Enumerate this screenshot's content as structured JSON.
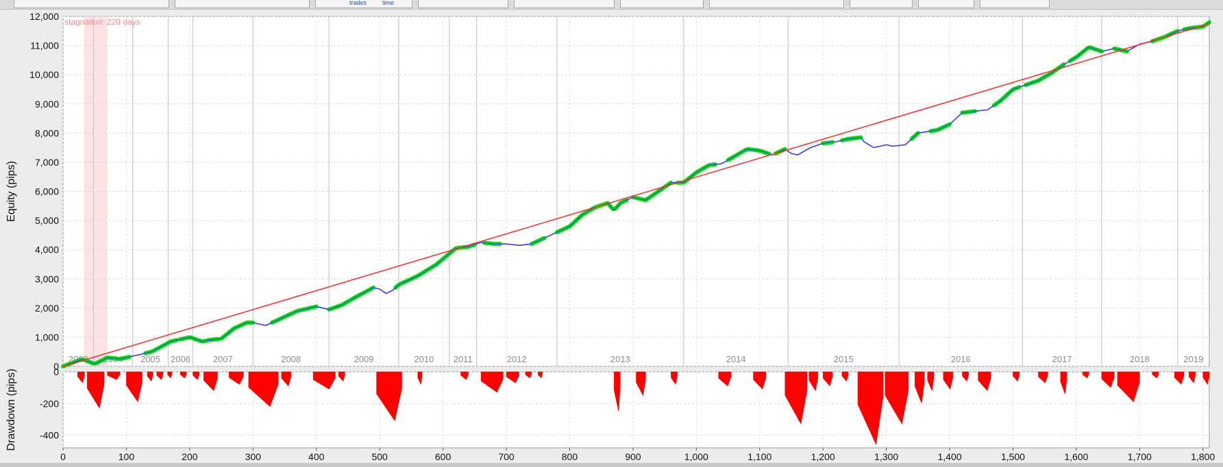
{
  "toolbar": {
    "trades_label": "trades",
    "time_label": "time"
  },
  "chart_data": [
    {
      "type": "line",
      "ylabel": "Equity (pips)",
      "ylim": [
        0,
        12000
      ],
      "yticks": [
        0,
        1000,
        2000,
        3000,
        4000,
        5000,
        6000,
        7000,
        8000,
        9000,
        10000,
        11000,
        12000
      ],
      "ytick_labels": [
        "0",
        "1,000",
        "2,000",
        "3,000",
        "4,000",
        "5,000",
        "6,000",
        "7,000",
        "8,000",
        "9,000",
        "10,000",
        "11,000",
        "12,000"
      ],
      "xlim": [
        0,
        1810
      ],
      "annotation": "stagnation: 220 days",
      "stagnation_range": [
        33,
        70
      ],
      "year_labels": [
        "2003",
        "2004",
        "2005",
        "2006",
        "2007",
        "2008",
        "2009",
        "2010",
        "2011",
        "2012",
        "2013",
        "2014",
        "2015",
        "2016",
        "2017",
        "2018",
        "2019"
      ],
      "year_boundaries": [
        48,
        110,
        166,
        205,
        300,
        420,
        530,
        610,
        653,
        780,
        980,
        1145,
        1320,
        1515,
        1640,
        1760
      ],
      "trend_line": {
        "x": [
          0,
          1810
        ],
        "y": [
          0,
          11750
        ]
      },
      "series": [
        {
          "color": "#3b3bff",
          "x": [
            0,
            30,
            50,
            70,
            90,
            110,
            140,
            170,
            200,
            220,
            230,
            250,
            270,
            290,
            300,
            320,
            340,
            350,
            370,
            400,
            420,
            440,
            460,
            490,
            500,
            510,
            520,
            530,
            560,
            590,
            620,
            640,
            660,
            680,
            700,
            720,
            740,
            760,
            780,
            800,
            820,
            840,
            860,
            870,
            880,
            900,
            920,
            940,
            960,
            980,
            1000,
            1020,
            1040,
            1060,
            1080,
            1100,
            1120,
            1140,
            1150,
            1160,
            1180,
            1200,
            1220,
            1240,
            1260,
            1265,
            1280,
            1300,
            1310,
            1330,
            1350,
            1380,
            1400,
            1420,
            1440,
            1460,
            1480,
            1500,
            1520,
            1540,
            1560,
            1580,
            1600,
            1620,
            1640,
            1660,
            1680,
            1700,
            1720,
            1740,
            1760,
            1780,
            1800,
            1810
          ],
          "y": [
            0,
            250,
            80,
            300,
            250,
            350,
            500,
            850,
            1000,
            850,
            900,
            950,
            1300,
            1500,
            1500,
            1400,
            1600,
            1700,
            1900,
            2050,
            1950,
            2100,
            2350,
            2700,
            2650,
            2500,
            2600,
            2800,
            3100,
            3500,
            4050,
            4100,
            4250,
            4200,
            4200,
            4150,
            4200,
            4400,
            4600,
            4800,
            5200,
            5450,
            5600,
            5350,
            5600,
            5800,
            5700,
            6000,
            6300,
            6300,
            6650,
            6900,
            6950,
            7200,
            7450,
            7400,
            7250,
            7450,
            7300,
            7250,
            7500,
            7650,
            7700,
            7800,
            7850,
            7700,
            7500,
            7600,
            7550,
            7600,
            8000,
            8100,
            8300,
            8700,
            8750,
            8800,
            9100,
            9500,
            9650,
            9800,
            10050,
            10350,
            10600,
            10950,
            10800,
            10900,
            10800,
            11050,
            11150,
            11300,
            11500,
            11600,
            11650,
            11800
          ]
        },
        {
          "color": "#00e000",
          "name_hidden": true,
          "segments": [
            [
              0,
              70
            ],
            [
              72,
              105
            ],
            [
              130,
              180
            ],
            [
              185,
              245
            ],
            [
              250,
              300
            ],
            [
              330,
              400
            ],
            [
              420,
              490
            ],
            [
              525,
              650
            ],
            [
              665,
              690
            ],
            [
              740,
              760
            ],
            [
              780,
              890
            ],
            [
              900,
              960
            ],
            [
              970,
              1030
            ],
            [
              1050,
              1115
            ],
            [
              1125,
              1140
            ],
            [
              1200,
              1215
            ],
            [
              1230,
              1260
            ],
            [
              1340,
              1350
            ],
            [
              1370,
              1400
            ],
            [
              1420,
              1440
            ],
            [
              1470,
              1510
            ],
            [
              1520,
              1580
            ],
            [
              1590,
              1640
            ],
            [
              1660,
              1680
            ],
            [
              1720,
              1760
            ],
            [
              1770,
              1810
            ]
          ]
        }
      ]
    },
    {
      "type": "area",
      "ylabel": "Drawdown (pips)",
      "ylim": [
        -480,
        0
      ],
      "yticks": [
        0,
        -200,
        -400
      ],
      "ytick_labels": [
        "0",
        "-200",
        "-400"
      ],
      "xticks": [
        0,
        100,
        200,
        300,
        400,
        500,
        600,
        700,
        800,
        900,
        1000,
        1100,
        1200,
        1300,
        1400,
        1500,
        1600,
        1700,
        1800
      ],
      "xtick_labels": [
        "0",
        "100",
        "200",
        "300",
        "400",
        "500",
        "600",
        "700",
        "800",
        "900",
        "1,000",
        "1,100",
        "1,200",
        "1,300",
        "1,400",
        "1,500",
        "1,600",
        "1,700",
        "1,800"
      ],
      "color": "#ff0000",
      "dips": [
        [
          23,
          34,
          -70
        ],
        [
          38,
          65,
          -230
        ],
        [
          70,
          90,
          -50
        ],
        [
          100,
          125,
          -190
        ],
        [
          133,
          142,
          -60
        ],
        [
          148,
          158,
          -50
        ],
        [
          165,
          172,
          -40
        ],
        [
          185,
          195,
          -40
        ],
        [
          205,
          215,
          -50
        ],
        [
          222,
          244,
          -120
        ],
        [
          262,
          285,
          -80
        ],
        [
          293,
          340,
          -220
        ],
        [
          345,
          360,
          -90
        ],
        [
          395,
          430,
          -110
        ],
        [
          435,
          445,
          -60
        ],
        [
          495,
          535,
          -310
        ],
        [
          560,
          567,
          -80
        ],
        [
          628,
          640,
          -50
        ],
        [
          660,
          695,
          -130
        ],
        [
          700,
          720,
          -70
        ],
        [
          730,
          740,
          -40
        ],
        [
          750,
          757,
          -40
        ],
        [
          870,
          880,
          -250
        ],
        [
          905,
          920,
          -150
        ],
        [
          960,
          970,
          -80
        ],
        [
          1035,
          1055,
          -90
        ],
        [
          1090,
          1110,
          -110
        ],
        [
          1140,
          1175,
          -330
        ],
        [
          1178,
          1192,
          -120
        ],
        [
          1200,
          1215,
          -90
        ],
        [
          1230,
          1240,
          -60
        ],
        [
          1255,
          1295,
          -460
        ],
        [
          1298,
          1335,
          -330
        ],
        [
          1345,
          1360,
          -200
        ],
        [
          1365,
          1375,
          -120
        ],
        [
          1390,
          1405,
          -110
        ],
        [
          1420,
          1430,
          -60
        ],
        [
          1445,
          1465,
          -120
        ],
        [
          1500,
          1510,
          -60
        ],
        [
          1540,
          1555,
          -70
        ],
        [
          1575,
          1585,
          -140
        ],
        [
          1610,
          1620,
          -40
        ],
        [
          1640,
          1660,
          -100
        ],
        [
          1665,
          1700,
          -190
        ],
        [
          1720,
          1730,
          -40
        ],
        [
          1755,
          1770,
          -80
        ],
        [
          1778,
          1788,
          -70
        ],
        [
          1800,
          1810,
          -80
        ]
      ]
    }
  ]
}
